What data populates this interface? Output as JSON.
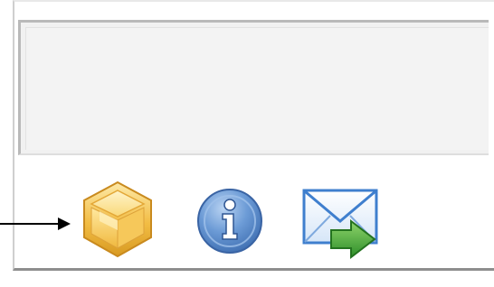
{
  "toolbar": {
    "buttons": [
      {
        "id": "package",
        "icon": "package-icon"
      },
      {
        "id": "info",
        "icon": "info-icon"
      },
      {
        "id": "email",
        "icon": "email-forward-icon"
      }
    ]
  },
  "annotation": {
    "icon": "pointer-arrow",
    "color": "#000000"
  },
  "colors": {
    "text_area_bg": "#f1f1f1",
    "box_gold": "#f4c74a",
    "info_blue": "#4f86c9",
    "mail_blue": "#4a8ad6",
    "mail_arrow_green": "#3da13a"
  }
}
